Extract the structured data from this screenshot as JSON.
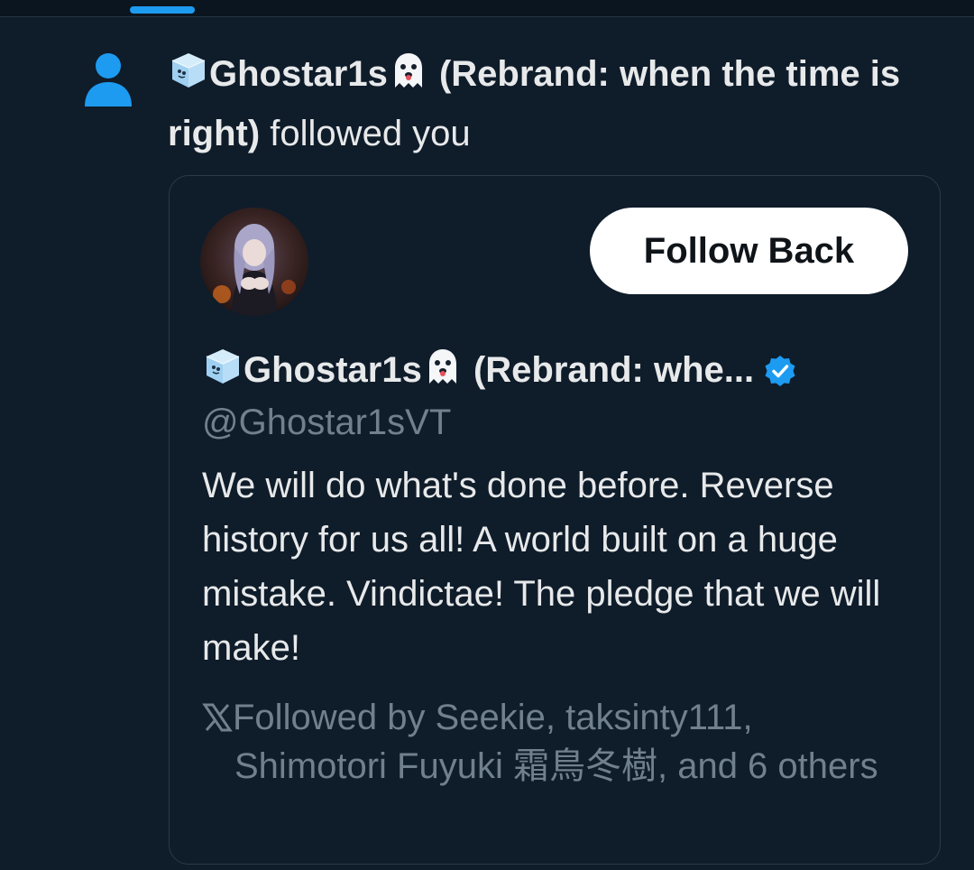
{
  "notification": {
    "name": "Ghostar1s",
    "name_rest": " (Rebrand: when the time is right)",
    "action": " followed you"
  },
  "card": {
    "follow_button_label": "Follow Back",
    "display_name": "Ghostar1s",
    "display_name_rest": " (Rebrand: whe...",
    "handle": "@Ghostar1sVT",
    "bio": "We will do what's done before. Reverse history for us all! A world built on a huge mistake. Vindictae! The pledge that we will make!",
    "followed_by": "Followed by Seekie, taksinty111, Shimotori Fuyuki 霜鳥冬樹, and 6 others"
  },
  "icons": {
    "notification_type": "person-icon",
    "name_prefix": "ice-cube-emoji",
    "name_suffix": "ghost-emoji",
    "verified": "verified-badge-icon",
    "followed_by": "x-logo-icon"
  },
  "colors": {
    "background": "#0f1c2a",
    "accent": "#1d9bf0",
    "text_primary": "#e7e9ea",
    "text_secondary": "#71808e",
    "button_bg": "#ffffff"
  }
}
